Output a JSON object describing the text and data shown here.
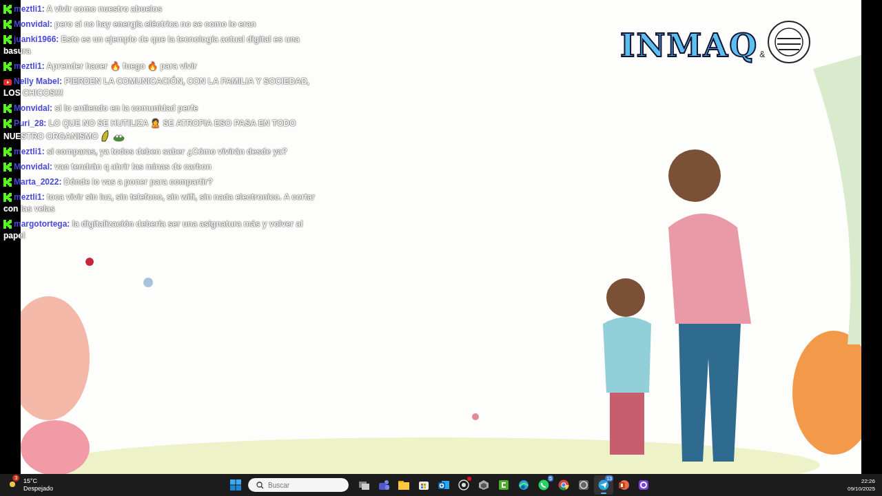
{
  "chat": {
    "messages": [
      {
        "kind": "kick",
        "user": "meztli1:",
        "text": "A vivir como nuestro abuelos"
      },
      {
        "kind": "kick",
        "user": "Monvidal:",
        "text": "pero si no hay energía eléctrica no se como lo eran"
      },
      {
        "kind": "kick",
        "user": "juanki1966:",
        "text": "Esto es un ejemplo de que la tecnología actual digital es una basura"
      },
      {
        "kind": "kick",
        "user": "meztli1:",
        "text": "Aprender hacer 🔥 fuego 🔥 para vivir"
      },
      {
        "kind": "youtube",
        "user": "Nelly Mabel:",
        "text": "PIERDEN LA COMUNICACIÓN, CON LA FAMILIA Y SOCIEDAD, LOS CHICOS!!!"
      },
      {
        "kind": "kick",
        "user": "Monvidal:",
        "text": "si lo entiendo en la comunidad perfe"
      },
      {
        "kind": "kick",
        "user": "Puri_28:",
        "text": "LO QUE NO SE HUTILIZA 🙎 SE ATROFIA ESO PASA EN TODO NUESTRO ORGANISMO",
        "emotes": [
          {
            "kind": "banana"
          },
          {
            "kind": "frog"
          }
        ]
      },
      {
        "kind": "kick",
        "user": "meztli1:",
        "text": "si comparas, ya todos deben saber ¿Cómo vivirán desde ya?"
      },
      {
        "kind": "kick",
        "user": "Monvidal:",
        "text": "van tendrán q abrir las minas de carbon"
      },
      {
        "kind": "kick",
        "user": "Marta_2022:",
        "text": "Dónde lo vas a poner para compartir?"
      },
      {
        "kind": "kick",
        "user": "meztli1:",
        "text": "toca vivir sin luz, sin telefono, sin wifi, sin nada electronico. A cortar con las velas"
      },
      {
        "kind": "kick",
        "user": "margotortega:",
        "text": "la digitalización debería ser una asignatura más y volver al papel"
      }
    ]
  },
  "brand_logo": {
    "text": "INMAQ",
    "ampersand": "&"
  },
  "taskbar": {
    "weather": {
      "badge": "3",
      "temperature": "15°C",
      "condition": "Despejado"
    },
    "search": {
      "placeholder": "Buscar"
    },
    "apps": [
      {
        "kind": "task-view",
        "selected": false
      },
      {
        "kind": "teams",
        "selected": false
      },
      {
        "kind": "folder",
        "selected": false
      },
      {
        "kind": "store",
        "selected": false
      },
      {
        "kind": "mail",
        "selected": false
      },
      {
        "kind": "recorder",
        "selected": false,
        "dot": true
      },
      {
        "kind": "cube",
        "selected": false
      },
      {
        "kind": "editor",
        "selected": false
      },
      {
        "kind": "browser-wave",
        "selected": false
      },
      {
        "kind": "phone-chat",
        "selected": false,
        "badge": "5"
      },
      {
        "kind": "browser-circle",
        "selected": false
      },
      {
        "kind": "globe",
        "selected": false
      },
      {
        "kind": "paper-plane",
        "selected": true,
        "badge": "13"
      },
      {
        "kind": "slides",
        "selected": false
      },
      {
        "kind": "ring",
        "selected": false
      }
    ],
    "clock": {
      "time": "22:26",
      "date": "09/10/2025"
    }
  }
}
